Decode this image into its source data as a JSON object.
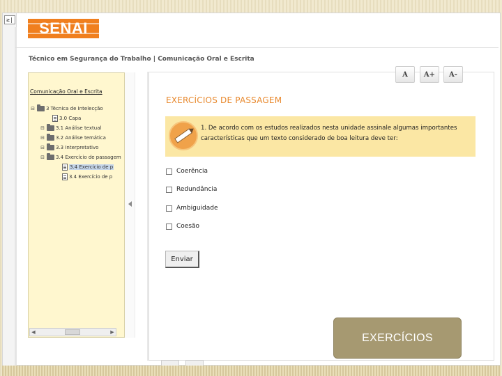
{
  "window": {
    "gutter_button": "≥|"
  },
  "header": {
    "logo_text": "SENAI",
    "breadcrumb": "Técnico em Segurança do Trabalho | Comunicação Oral e Escrita"
  },
  "toolbar": {
    "accessibility_label": "A",
    "increase_font_label": "A+",
    "decrease_font_label": "A-"
  },
  "tree": {
    "title": "Comunicação Oral e Escrita",
    "items": [
      {
        "expander": "⊟",
        "icon": "folder",
        "label": "3 Técnica de Intelecção"
      },
      {
        "expander": "",
        "icon": "doc",
        "label": "3.0 Capa"
      },
      {
        "expander": "⊟",
        "icon": "folder",
        "label": "3.1 Análise textual"
      },
      {
        "expander": "⊟",
        "icon": "folder",
        "label": "3.2 Análise temática"
      },
      {
        "expander": "⊟",
        "icon": "folder",
        "label": "3.3 Interpretativo"
      },
      {
        "expander": "⊟",
        "icon": "folder",
        "label": "3.4 Exercício de passagem"
      },
      {
        "expander": "",
        "icon": "doc",
        "label": "3.4 Exercício de p",
        "selected": true
      },
      {
        "expander": "",
        "icon": "doc",
        "label": "3.4 Exercício de p"
      }
    ]
  },
  "content": {
    "section_title": "EXERCÍCIOS DE PASSAGEM",
    "question": "1. De acordo com os estudos realizados nesta unidade assinale algumas importantes características que um texto considerado de boa leitura deve ter:",
    "options": [
      "Coerência",
      "Redundância",
      "Ambiguidade",
      "Coesão"
    ],
    "submit_label": "Enviar"
  },
  "badge": {
    "label": "EXERCÍCIOS"
  },
  "colors": {
    "logo": "#f07f1e",
    "title": "#e8892e",
    "question_bg": "#fbe7a4",
    "tree_bg": "#fff7cf",
    "badge_bg": "#a69971"
  }
}
